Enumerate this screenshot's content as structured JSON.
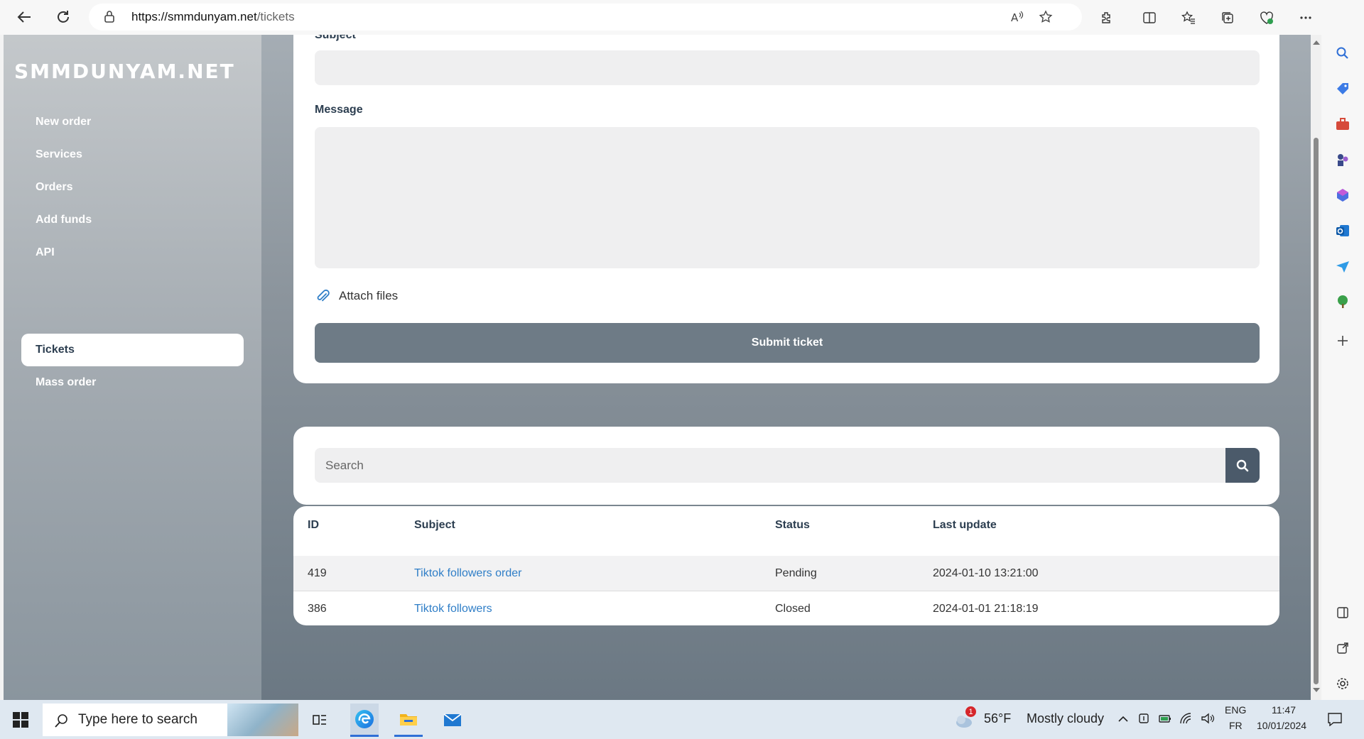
{
  "browser": {
    "url_host": "https://smmdunyam.net",
    "url_path": "/tickets"
  },
  "sidebar": {
    "logo": "SMMDUNYAM.NET",
    "items": [
      {
        "label": "New order"
      },
      {
        "label": "Services"
      },
      {
        "label": "Orders"
      },
      {
        "label": "Add funds"
      },
      {
        "label": "API"
      },
      {
        "label": "Tickets",
        "active": true
      },
      {
        "label": "Mass order"
      }
    ]
  },
  "ticket_form": {
    "subject_label": "Subject",
    "message_label": "Message",
    "attach_label": "Attach files",
    "submit_label": "Submit ticket"
  },
  "search": {
    "placeholder": "Search"
  },
  "tickets_table": {
    "headers": [
      "ID",
      "Subject",
      "Status",
      "Last update"
    ],
    "rows": [
      {
        "id": "419",
        "subject": "Tiktok followers order",
        "status": "Pending",
        "last_update": "2024-01-10 13:21:00"
      },
      {
        "id": "386",
        "subject": "Tiktok followers",
        "status": "Closed",
        "last_update": "2024-01-01 21:18:19"
      }
    ]
  },
  "taskbar": {
    "search_placeholder": "Type here to search",
    "weather_temp": "56°F",
    "weather_desc": "Mostly cloudy",
    "weather_badge": "1",
    "lang_top": "ENG",
    "lang_bottom": "FR",
    "time": "11:47",
    "date": "10/01/2024"
  },
  "colors": {
    "accent": "#4b5a6a",
    "submit": "#6e7b86",
    "link": "#2f7ec7"
  }
}
